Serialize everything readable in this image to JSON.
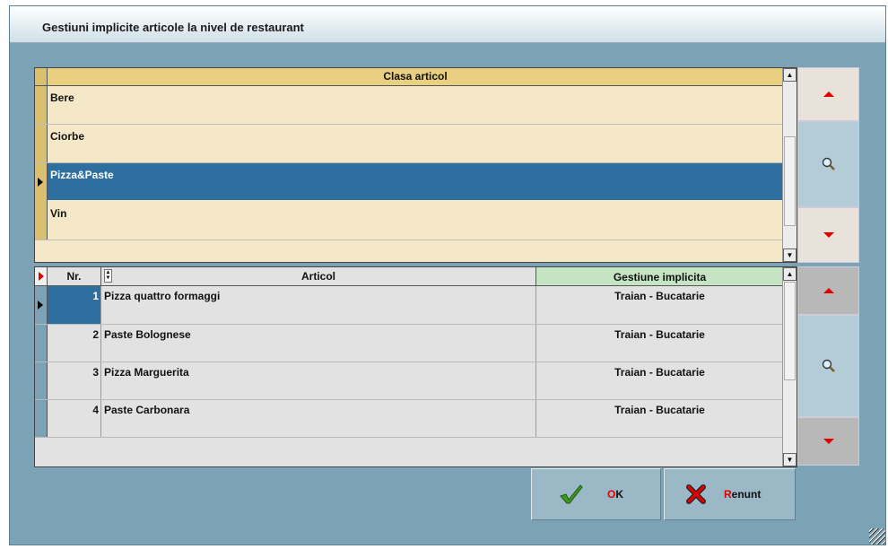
{
  "window": {
    "title": "Gestiuni implicite articole la nivel de restaurant"
  },
  "class_grid": {
    "header": "Clasa articol",
    "rows": [
      {
        "label": "Bere",
        "selected": false
      },
      {
        "label": "Ciorbe",
        "selected": false
      },
      {
        "label": "Pizza&Paste",
        "selected": true
      },
      {
        "label": "Vin",
        "selected": false
      }
    ]
  },
  "article_grid": {
    "headers": {
      "nr": "Nr.",
      "articol": "Articol",
      "gestiune": "Gestiune implicita"
    },
    "rows": [
      {
        "nr": "1",
        "articol": "Pizza quattro formaggi",
        "gestiune": "Traian - Bucatarie"
      },
      {
        "nr": "2",
        "articol": "Paste Bolognese",
        "gestiune": "Traian - Bucatarie"
      },
      {
        "nr": "3",
        "articol": "Pizza Marguerita",
        "gestiune": "Traian - Bucatarie"
      },
      {
        "nr": "4",
        "articol": "Paste Carbonara",
        "gestiune": "Traian - Bucatarie"
      }
    ]
  },
  "buttons": {
    "ok": {
      "hotkey": "O",
      "rest": "K"
    },
    "cancel": {
      "hotkey": "R",
      "rest": "enunt"
    }
  },
  "icons": {
    "up": "red-triangle-up-icon",
    "down": "red-triangle-down-icon",
    "search": "magnifier-icon",
    "ok": "green-check-icon",
    "cancel": "red-x-icon"
  },
  "colors": {
    "window_bg": "#7ba3b5",
    "class_row_bg": "#f5e8c8",
    "class_header_bg": "#e8d080",
    "selection_bg": "#2e6fa0",
    "article_row_bg": "#e2e2e2",
    "gestiune_header_bg": "#c4e4c4",
    "nav_up_down": "#e00000"
  }
}
